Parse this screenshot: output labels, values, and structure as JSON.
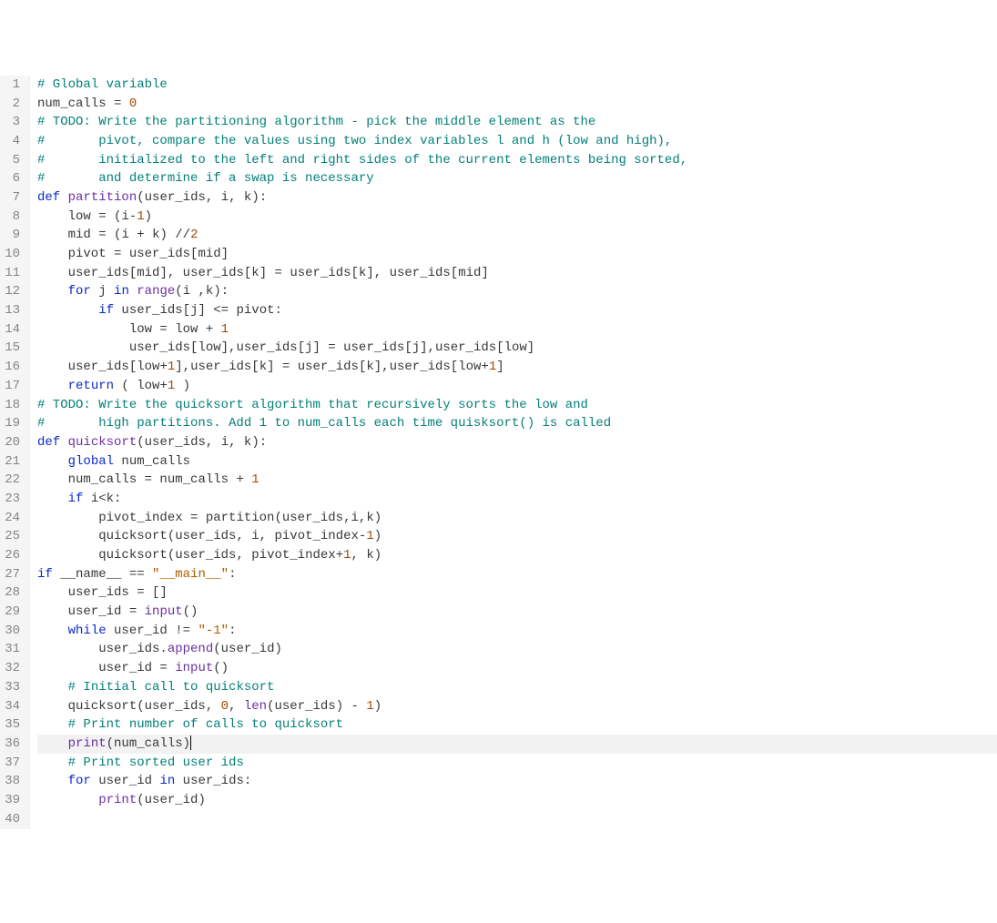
{
  "line_count": 40,
  "current_line": 36,
  "lines": {
    "1": [
      [
        "comment",
        "# Global variable"
      ]
    ],
    "2": [
      [
        "id",
        "num_calls "
      ],
      [
        "op",
        "= "
      ],
      [
        "num",
        "0"
      ]
    ],
    "3": [
      [
        "comment",
        "# TODO: Write the partitioning algorithm - pick the middle element as the"
      ]
    ],
    "4": [
      [
        "comment",
        "#       pivot, compare the values using two index variables l and h (low and high),"
      ]
    ],
    "5": [
      [
        "comment",
        "#       initialized to the left and right sides of the current elements being sorted,"
      ]
    ],
    "6": [
      [
        "comment",
        "#       and determine if a swap is necessary"
      ]
    ],
    "7": [
      [
        "kw",
        "def"
      ],
      [
        "id",
        " "
      ],
      [
        "func",
        "partition"
      ],
      [
        "op",
        "("
      ],
      [
        "id",
        "user_ids"
      ],
      [
        "op",
        ", "
      ],
      [
        "id",
        "i"
      ],
      [
        "op",
        ", "
      ],
      [
        "id",
        "k"
      ],
      [
        "op",
        "):"
      ]
    ],
    "8": [
      [
        "id",
        "    low "
      ],
      [
        "op",
        "= ("
      ],
      [
        "id",
        "i"
      ],
      [
        "op",
        "-"
      ],
      [
        "num",
        "1"
      ],
      [
        "op",
        ")"
      ]
    ],
    "9": [
      [
        "id",
        "    mid "
      ],
      [
        "op",
        "= ("
      ],
      [
        "id",
        "i "
      ],
      [
        "op",
        "+ "
      ],
      [
        "id",
        "k"
      ],
      [
        "op",
        ") //"
      ],
      [
        "num",
        "2"
      ]
    ],
    "10": [
      [
        "id",
        "    pivot "
      ],
      [
        "op",
        "= "
      ],
      [
        "id",
        "user_ids"
      ],
      [
        "op",
        "["
      ],
      [
        "id",
        "mid"
      ],
      [
        "op",
        "]"
      ]
    ],
    "11": [
      [
        "id",
        "    user_ids"
      ],
      [
        "op",
        "["
      ],
      [
        "id",
        "mid"
      ],
      [
        "op",
        "], "
      ],
      [
        "id",
        "user_ids"
      ],
      [
        "op",
        "["
      ],
      [
        "id",
        "k"
      ],
      [
        "op",
        "] = "
      ],
      [
        "id",
        "user_ids"
      ],
      [
        "op",
        "["
      ],
      [
        "id",
        "k"
      ],
      [
        "op",
        "], "
      ],
      [
        "id",
        "user_ids"
      ],
      [
        "op",
        "["
      ],
      [
        "id",
        "mid"
      ],
      [
        "op",
        "]"
      ]
    ],
    "12": [
      [
        "id",
        "    "
      ],
      [
        "kw",
        "for"
      ],
      [
        "id",
        " j "
      ],
      [
        "kw",
        "in"
      ],
      [
        "id",
        " "
      ],
      [
        "func",
        "range"
      ],
      [
        "op",
        "("
      ],
      [
        "id",
        "i "
      ],
      [
        "op",
        ","
      ],
      [
        "id",
        "k"
      ],
      [
        "op",
        "):"
      ]
    ],
    "13": [
      [
        "id",
        "        "
      ],
      [
        "kw",
        "if"
      ],
      [
        "id",
        " user_ids"
      ],
      [
        "op",
        "["
      ],
      [
        "id",
        "j"
      ],
      [
        "op",
        "] <= "
      ],
      [
        "id",
        "pivot"
      ],
      [
        "op",
        ":"
      ]
    ],
    "14": [
      [
        "id",
        "            low "
      ],
      [
        "op",
        "= "
      ],
      [
        "id",
        "low "
      ],
      [
        "op",
        "+ "
      ],
      [
        "num",
        "1"
      ]
    ],
    "15": [
      [
        "id",
        "            user_ids"
      ],
      [
        "op",
        "["
      ],
      [
        "id",
        "low"
      ],
      [
        "op",
        "],"
      ],
      [
        "id",
        "user_ids"
      ],
      [
        "op",
        "["
      ],
      [
        "id",
        "j"
      ],
      [
        "op",
        "] = "
      ],
      [
        "id",
        "user_ids"
      ],
      [
        "op",
        "["
      ],
      [
        "id",
        "j"
      ],
      [
        "op",
        "],"
      ],
      [
        "id",
        "user_ids"
      ],
      [
        "op",
        "["
      ],
      [
        "id",
        "low"
      ],
      [
        "op",
        "]"
      ]
    ],
    "16": [
      [
        "id",
        "    user_ids"
      ],
      [
        "op",
        "["
      ],
      [
        "id",
        "low"
      ],
      [
        "op",
        "+"
      ],
      [
        "num",
        "1"
      ],
      [
        "op",
        "],"
      ],
      [
        "id",
        "user_ids"
      ],
      [
        "op",
        "["
      ],
      [
        "id",
        "k"
      ],
      [
        "op",
        "] = "
      ],
      [
        "id",
        "user_ids"
      ],
      [
        "op",
        "["
      ],
      [
        "id",
        "k"
      ],
      [
        "op",
        "],"
      ],
      [
        "id",
        "user_ids"
      ],
      [
        "op",
        "["
      ],
      [
        "id",
        "low"
      ],
      [
        "op",
        "+"
      ],
      [
        "num",
        "1"
      ],
      [
        "op",
        "]"
      ]
    ],
    "17": [
      [
        "id",
        "    "
      ],
      [
        "kw",
        "return"
      ],
      [
        "op",
        " ( "
      ],
      [
        "id",
        "low"
      ],
      [
        "op",
        "+"
      ],
      [
        "num",
        "1"
      ],
      [
        "op",
        " )"
      ]
    ],
    "18": [
      [
        "comment",
        "# TODO: Write the quicksort algorithm that recursively sorts the low and"
      ]
    ],
    "19": [
      [
        "comment",
        "#       high partitions. Add 1 to num_calls each time quisksort() is called"
      ]
    ],
    "20": [
      [
        "kw",
        "def"
      ],
      [
        "id",
        " "
      ],
      [
        "func",
        "quicksort"
      ],
      [
        "op",
        "("
      ],
      [
        "id",
        "user_ids"
      ],
      [
        "op",
        ", "
      ],
      [
        "id",
        "i"
      ],
      [
        "op",
        ", "
      ],
      [
        "id",
        "k"
      ],
      [
        "op",
        "):"
      ]
    ],
    "21": [
      [
        "id",
        "    "
      ],
      [
        "kw",
        "global"
      ],
      [
        "id",
        " num_calls"
      ]
    ],
    "22": [
      [
        "id",
        "    num_calls "
      ],
      [
        "op",
        "="
      ],
      [
        "id",
        " num_calls "
      ],
      [
        "op",
        "+ "
      ],
      [
        "num",
        "1"
      ]
    ],
    "23": [
      [
        "id",
        "    "
      ],
      [
        "kw",
        "if"
      ],
      [
        "id",
        " i"
      ],
      [
        "op",
        "<"
      ],
      [
        "id",
        "k"
      ],
      [
        "op",
        ":"
      ]
    ],
    "24": [
      [
        "id",
        "        pivot_index "
      ],
      [
        "op",
        "= "
      ],
      [
        "id",
        "partition"
      ],
      [
        "op",
        "("
      ],
      [
        "id",
        "user_ids"
      ],
      [
        "op",
        ","
      ],
      [
        "id",
        "i"
      ],
      [
        "op",
        ","
      ],
      [
        "id",
        "k"
      ],
      [
        "op",
        ")"
      ]
    ],
    "25": [
      [
        "id",
        "        quicksort"
      ],
      [
        "op",
        "("
      ],
      [
        "id",
        "user_ids"
      ],
      [
        "op",
        ", "
      ],
      [
        "id",
        "i"
      ],
      [
        "op",
        ", "
      ],
      [
        "id",
        "pivot_index"
      ],
      [
        "op",
        "-"
      ],
      [
        "num",
        "1"
      ],
      [
        "op",
        ")"
      ]
    ],
    "26": [
      [
        "id",
        "        quicksort"
      ],
      [
        "op",
        "("
      ],
      [
        "id",
        "user_ids"
      ],
      [
        "op",
        ", "
      ],
      [
        "id",
        "pivot_index"
      ],
      [
        "op",
        "+"
      ],
      [
        "num",
        "1"
      ],
      [
        "op",
        ", "
      ],
      [
        "id",
        "k"
      ],
      [
        "op",
        ")"
      ]
    ],
    "27": [
      [
        "kw",
        "if"
      ],
      [
        "id",
        " __name__ "
      ],
      [
        "op",
        "== "
      ],
      [
        "str",
        "\"__main__\""
      ],
      [
        "op",
        ":"
      ]
    ],
    "28": [
      [
        "id",
        "    user_ids "
      ],
      [
        "op",
        "= []"
      ]
    ],
    "29": [
      [
        "id",
        "    user_id "
      ],
      [
        "op",
        "= "
      ],
      [
        "func",
        "input"
      ],
      [
        "op",
        "()"
      ]
    ],
    "30": [
      [
        "id",
        "    "
      ],
      [
        "kw",
        "while"
      ],
      [
        "id",
        " user_id "
      ],
      [
        "op",
        "!= "
      ],
      [
        "str",
        "\"-1\""
      ],
      [
        "op",
        ":"
      ]
    ],
    "31": [
      [
        "id",
        "        user_ids"
      ],
      [
        "op",
        "."
      ],
      [
        "func",
        "append"
      ],
      [
        "op",
        "("
      ],
      [
        "id",
        "user_id"
      ],
      [
        "op",
        ")"
      ]
    ],
    "32": [
      [
        "id",
        "        user_id "
      ],
      [
        "op",
        "= "
      ],
      [
        "func",
        "input"
      ],
      [
        "op",
        "()"
      ]
    ],
    "33": [
      [
        "id",
        "    "
      ],
      [
        "comment",
        "# Initial call to quicksort"
      ]
    ],
    "34": [
      [
        "id",
        "    quicksort"
      ],
      [
        "op",
        "("
      ],
      [
        "id",
        "user_ids"
      ],
      [
        "op",
        ", "
      ],
      [
        "num",
        "0"
      ],
      [
        "op",
        ", "
      ],
      [
        "func",
        "len"
      ],
      [
        "op",
        "("
      ],
      [
        "id",
        "user_ids"
      ],
      [
        "op",
        ") - "
      ],
      [
        "num",
        "1"
      ],
      [
        "op",
        ")"
      ]
    ],
    "35": [
      [
        "id",
        "    "
      ],
      [
        "comment",
        "# Print number of calls to quicksort"
      ]
    ],
    "36": [
      [
        "id",
        "    "
      ],
      [
        "func",
        "print"
      ],
      [
        "op",
        "("
      ],
      [
        "id",
        "num_calls"
      ],
      [
        "op",
        ")"
      ]
    ],
    "37": [
      [
        "id",
        "    "
      ],
      [
        "comment",
        "# Print sorted user ids"
      ]
    ],
    "38": [
      [
        "id",
        "    "
      ],
      [
        "kw",
        "for"
      ],
      [
        "id",
        " user_id "
      ],
      [
        "kw",
        "in"
      ],
      [
        "id",
        " user_ids"
      ],
      [
        "op",
        ":"
      ]
    ],
    "39": [
      [
        "id",
        "        "
      ],
      [
        "func",
        "print"
      ],
      [
        "op",
        "("
      ],
      [
        "id",
        "user_id"
      ],
      [
        "op",
        ")"
      ]
    ],
    "40": [
      [
        "id",
        ""
      ]
    ]
  }
}
